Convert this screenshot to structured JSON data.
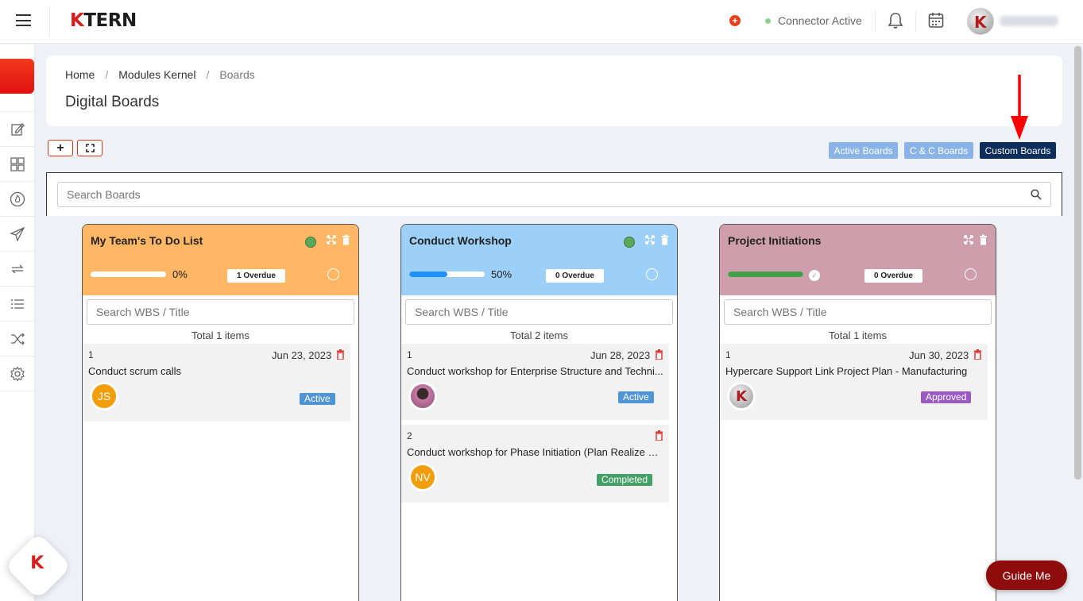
{
  "brand": {
    "logo_k": "K",
    "logo_rest": "TERN"
  },
  "topbar": {
    "connector_status": "Connector Active"
  },
  "breadcrumb": {
    "items": [
      "Home",
      "Modules Kernel",
      "Boards"
    ]
  },
  "page": {
    "title": "Digital Boards"
  },
  "tools": {
    "add": "+",
    "fullscreen": "⛶"
  },
  "board_tabs": [
    {
      "label": "Active Boards",
      "color": "#8ab4e8"
    },
    {
      "label": "C & C Boards",
      "color": "#8ab4e8"
    },
    {
      "label": "Custom Boards",
      "color": "#0d2d5a"
    }
  ],
  "search": {
    "placeholder": "Search Boards"
  },
  "wbs_placeholder": "Search WBS / Title",
  "boards": [
    {
      "title": "My Team's To Do List",
      "color": "#ffb766",
      "progress": 0,
      "percent_label": "0%",
      "overdue": "1 Overdue",
      "total": "Total 1 items",
      "cards": [
        {
          "num": "1",
          "date": "Jun 23, 2023",
          "title": "Conduct scrum calls",
          "avatar": "JS",
          "avatar_color": "#f29d0c",
          "status": "Active",
          "status_color": "#4f94d4"
        }
      ]
    },
    {
      "title": "Conduct Workshop",
      "color": "#9dd0f8",
      "progress": 50,
      "percent_label": "50%",
      "overdue": "0 Overdue",
      "total": "Total 2 items",
      "cards": [
        {
          "num": "1",
          "date": "Jun 28, 2023",
          "title": "Conduct workshop for Enterprise Structure and Techni...",
          "avatar": "",
          "avatar_color": "#7a4a5a",
          "status": "Active",
          "status_color": "#4f94d4"
        },
        {
          "num": "2",
          "date": "",
          "title": "Conduct workshop for Phase Initiation (Plan Realize Ph...",
          "avatar": "NV",
          "avatar_color": "#f29d0c",
          "status": "Completed",
          "status_color": "#43a066"
        }
      ]
    },
    {
      "title": "Project Initiations",
      "color": "#cf9eac",
      "progress": 100,
      "percent_label": "✓",
      "overdue": "0 Overdue",
      "total": "Total 1 items",
      "cards": [
        {
          "num": "1",
          "date": "Jun 30, 2023",
          "title": "Hypercare Support Link Project Plan - Manufacturing",
          "avatar": "K",
          "avatar_color": "#bdbdbd",
          "status": "Approved",
          "status_color": "#9b59c4"
        }
      ]
    }
  ],
  "guide": {
    "label": "Guide Me"
  },
  "colors": {
    "accent": "#d51f1f",
    "progress_blue": "#1e90ff",
    "progress_green": "#43a047"
  }
}
